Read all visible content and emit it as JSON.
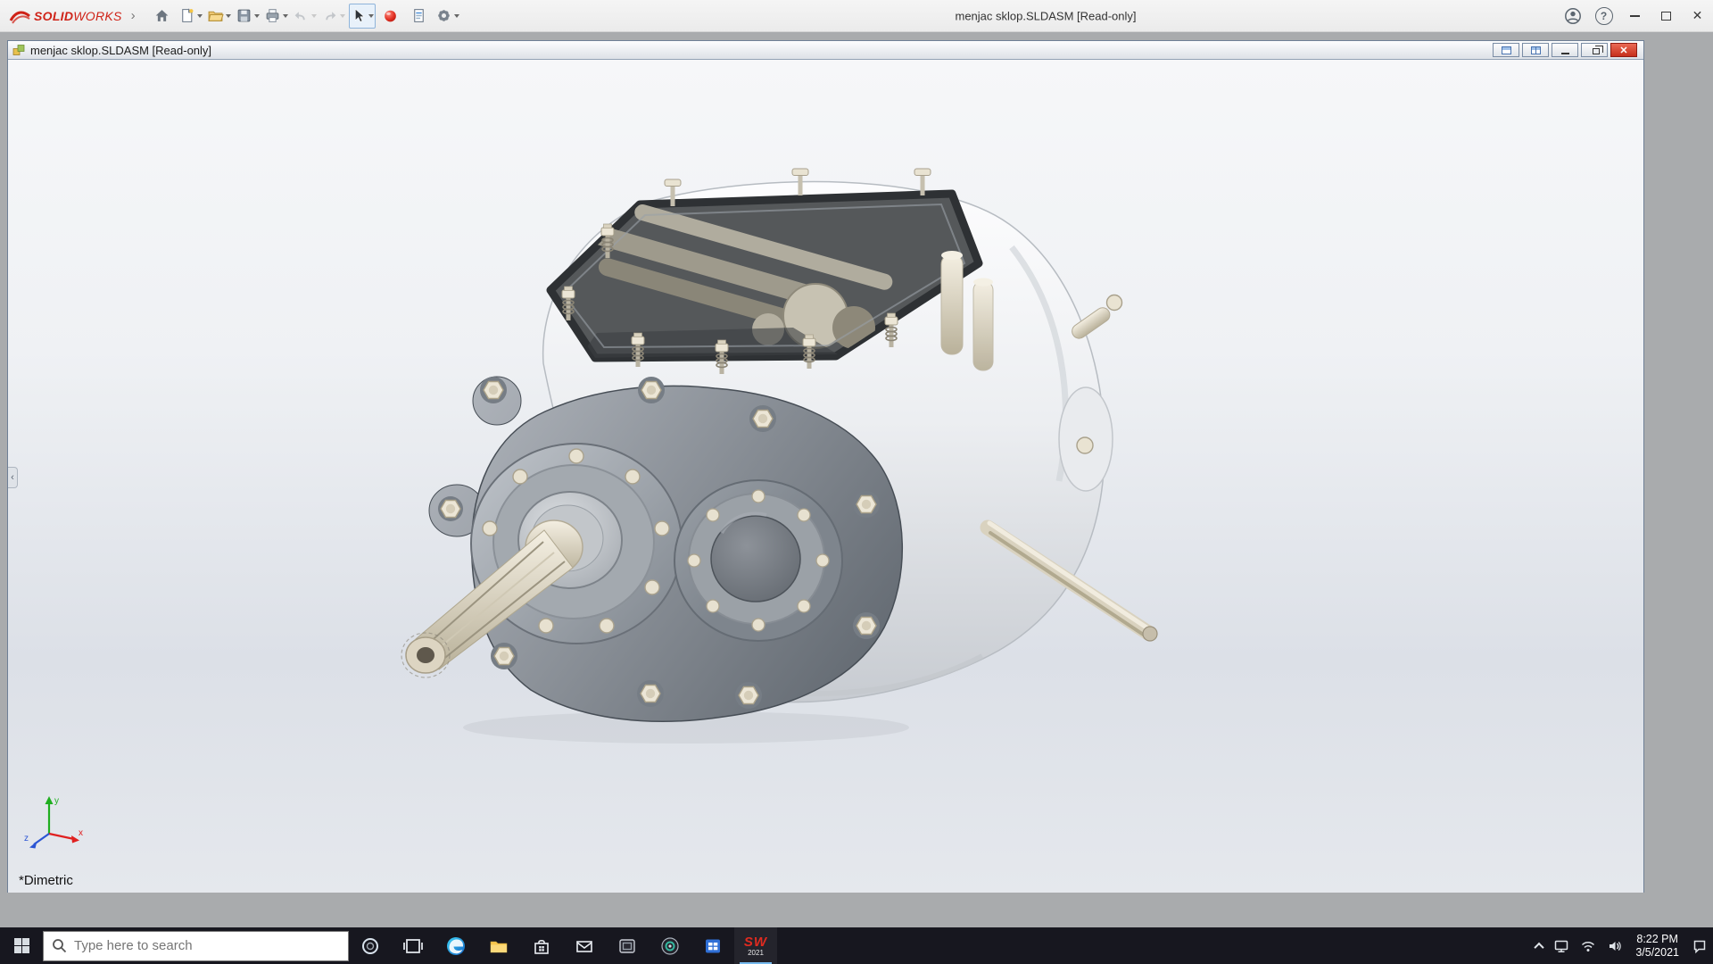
{
  "app_bar": {
    "brand_bold": "SOLID",
    "brand_light": "WORKS",
    "title": "menjac sklop.SLDASM [Read-only]"
  },
  "glyphs": {
    "flyout_arrow": "›",
    "help": "?",
    "close": "✕",
    "panel_collapse": "‹"
  },
  "toolbar_icons": [
    "home",
    "new-document",
    "open",
    "save",
    "print",
    "undo",
    "redo",
    "select",
    "rebuild",
    "file-properties",
    "options"
  ],
  "document_window": {
    "title": "menjac sklop.SLDASM [Read-only]",
    "view_orientation": "*Dimetric",
    "triad": {
      "x": "x",
      "y": "y",
      "z": "z"
    }
  },
  "taskbar": {
    "search_placeholder": "Type here to search",
    "pinned_apps": [
      "start",
      "search",
      "cortana",
      "task-view",
      "edge",
      "file-explorer",
      "store",
      "mail",
      "screenshot-app",
      "media-app",
      "blue-tiles-app",
      "solidworks-2021"
    ],
    "solidworks_badge": {
      "letters": "SW",
      "year": "2021"
    },
    "tray": {
      "time": "8:22 PM",
      "date": "3/5/2021"
    }
  }
}
